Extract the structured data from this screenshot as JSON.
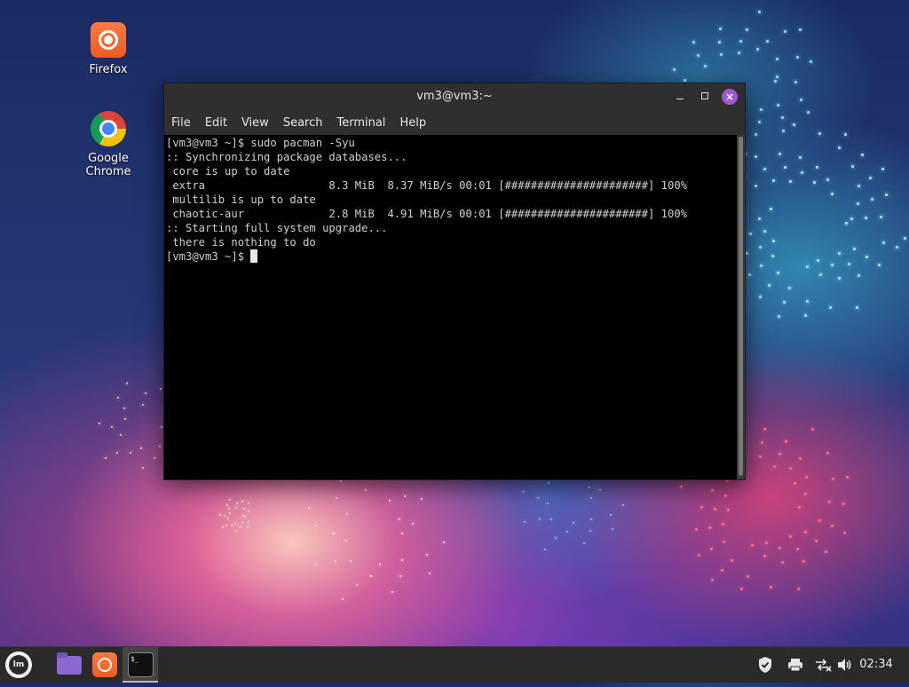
{
  "desktop": {
    "icons": [
      {
        "label": "Firefox",
        "icon": "firefox-icon"
      },
      {
        "label": "Google Chrome",
        "icon": "chrome-icon"
      }
    ]
  },
  "window": {
    "title": "vm3@vm3:~",
    "controls": {
      "minimize": "minimize-icon",
      "maximize": "maximize-icon",
      "close": "×"
    },
    "menu": [
      "File",
      "Edit",
      "View",
      "Search",
      "Terminal",
      "Help"
    ]
  },
  "terminal": {
    "lines": [
      "[vm3@vm3 ~]$ sudo pacman -Syu",
      ":: Synchronizing package databases...",
      " core is up to date",
      " extra                   8.3 MiB  8.37 MiB/s 00:01 [######################] 100%",
      " multilib is up to date",
      " chaotic-aur             2.8 MiB  4.91 MiB/s 00:01 [######################] 100%",
      ":: Starting full system upgrade...",
      " there is nothing to do"
    ],
    "prompt": "[vm3@vm3 ~]$ "
  },
  "taskbar": {
    "menu_icon": "linux-mint-menu-icon",
    "launchers": [
      "files-folder-icon",
      "firefox-icon",
      "terminal-icon"
    ],
    "terminal_glyph": "$_",
    "tray": {
      "shield": "shield-icon",
      "printer": "printer-icon",
      "network": "network-icon",
      "volume": "volume-icon"
    },
    "clock": "02:34"
  },
  "colors": {
    "accent_close": "#9b59d6",
    "terminal_bg": "#000000",
    "taskbar_bg": "#2a2a2a"
  }
}
